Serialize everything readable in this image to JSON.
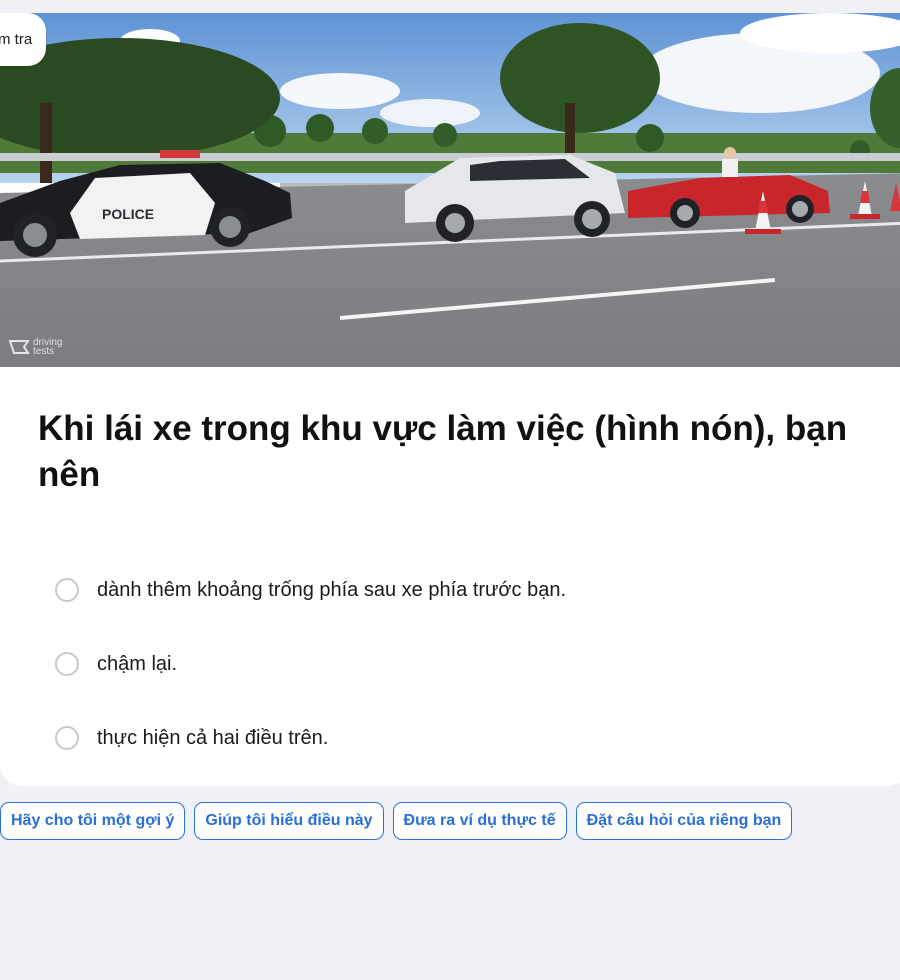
{
  "badge": {
    "label": "m tra"
  },
  "image": {
    "description_icon": "driving-scene-image",
    "watermark_text": "driving tests",
    "police_text": "POLICE"
  },
  "question": {
    "text": "Khi lái xe trong khu vực làm việc (hình nón), bạn nên"
  },
  "options": [
    {
      "label": "dành thêm khoảng trống phía sau xe phía trước bạn."
    },
    {
      "label": "chậm lại."
    },
    {
      "label": "thực hiện cả hai điều trên."
    }
  ],
  "help_chips": [
    {
      "label": "Hãy cho tôi một gợi ý"
    },
    {
      "label": "Giúp tôi hiểu điều này"
    },
    {
      "label": "Đưa ra ví dụ thực tế"
    },
    {
      "label": "Đặt câu hỏi của riêng bạn"
    }
  ],
  "colors": {
    "accent": "#2a73d9",
    "background": "#eff1f6"
  }
}
